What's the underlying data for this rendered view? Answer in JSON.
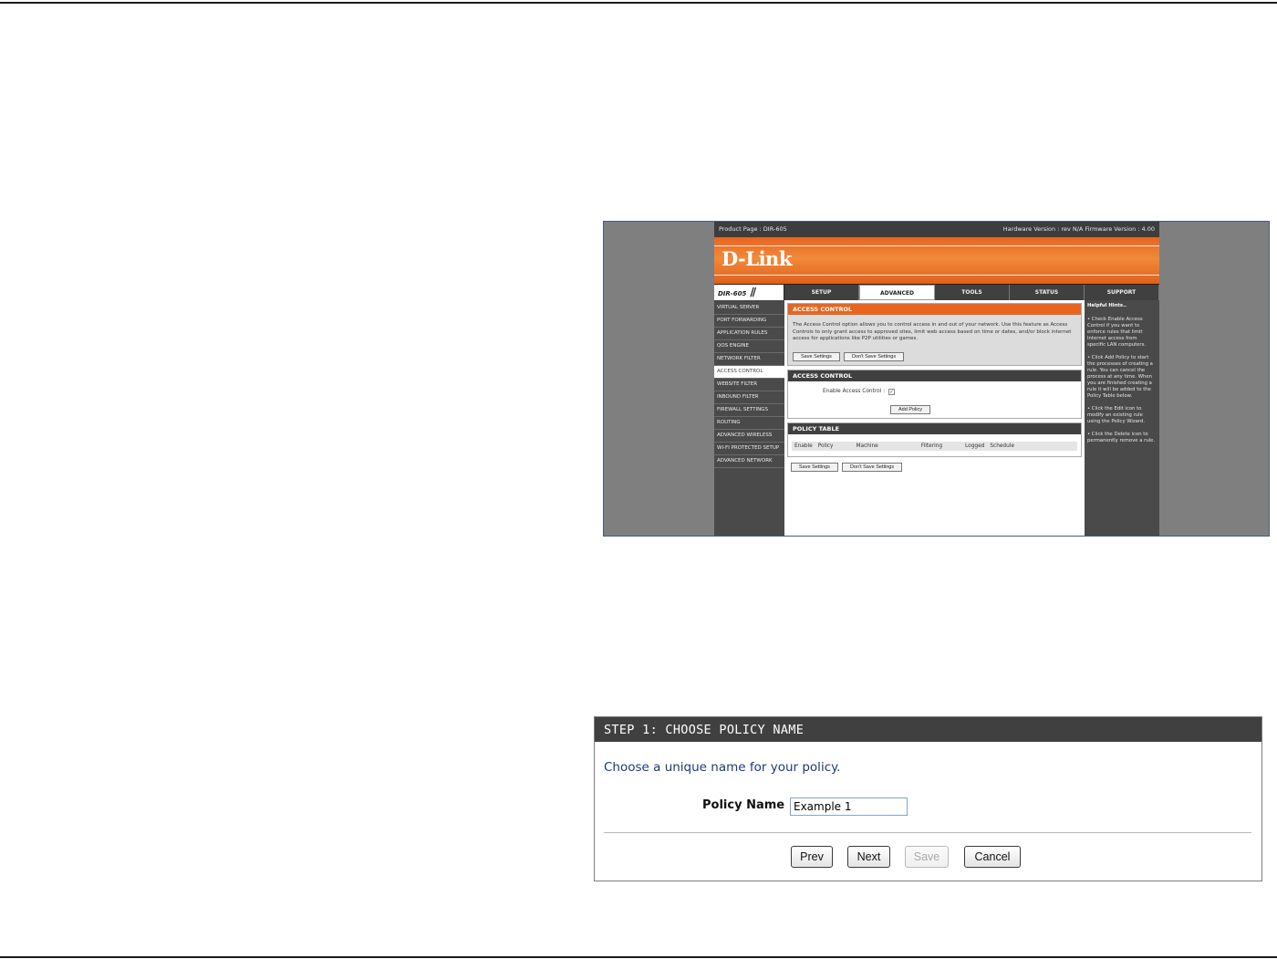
{
  "router": {
    "product_page": "Product Page : DIR-605",
    "versions": "Hardware Version : rev N/A   Firmware Version : 4.00",
    "logo": "D-Link",
    "model": "DIR-605",
    "tabs": [
      "SETUP",
      "ADVANCED",
      "TOOLS",
      "STATUS",
      "SUPPORT"
    ],
    "active_tab": "ADVANCED",
    "left_nav": [
      "VIRTUAL SERVER",
      "PORT FORWARDING",
      "APPLICATION RULES",
      "QOS ENGINE",
      "NETWORK FILTER",
      "ACCESS CONTROL",
      "WEBSITE FILTER",
      "INBOUND FILTER",
      "FIREWALL SETTINGS",
      "ROUTING",
      "ADVANCED WIRELESS",
      "WI-FI PROTECTED SETUP",
      "ADVANCED NETWORK"
    ],
    "active_nav": "ACCESS CONTROL",
    "intro_heading": "ACCESS CONTROL",
    "intro_text": "The Access Control option allows you to control access in and out of your network. Use this feature as Access Controls to only grant access to approved sites, limit web access based on time or dates, and/or block internet access for applications like P2P utilities or games.",
    "save_settings": "Save Settings",
    "dont_save_settings": "Don't Save Settings",
    "ac_heading": "ACCESS CONTROL",
    "enable_label": "Enable Access Control :",
    "add_policy": "Add Policy",
    "policy_heading": "POLICY TABLE",
    "policy_columns": [
      "Enable",
      "Policy",
      "Machine",
      "Filtering",
      "Logged",
      "Schedule"
    ],
    "help_title": "Helpful Hints..",
    "help_items": [
      "• Check Enable Access Control if you want to enforce rules that limit Internet access from specific LAN computers.",
      "• Click Add Policy to start the processes of creating a rule. You can cancel the process at any time. When you are finished creating a rule it will be added to the Policy Table below.",
      "• Click the Edit icon to modify an existing rule using the Policy Wizard.",
      "• Click the Delete icon to permanently remove a rule."
    ]
  },
  "wizard": {
    "header": "STEP 1: CHOOSE POLICY NAME",
    "instruction": "Choose a unique name for your policy.",
    "policy_name_label": "Policy Name :",
    "policy_name_value": "Example 1",
    "buttons": {
      "prev": "Prev",
      "next": "Next",
      "save": "Save",
      "cancel": "Cancel"
    },
    "save_disabled": true
  }
}
